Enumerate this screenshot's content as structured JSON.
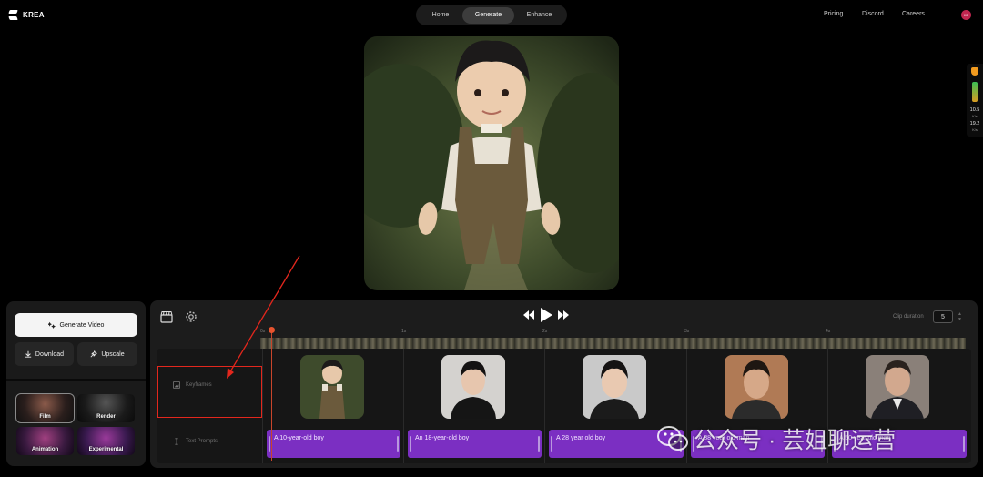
{
  "app": {
    "brand": "KREA"
  },
  "nav": {
    "tabs": [
      {
        "label": "Home",
        "active": false
      },
      {
        "label": "Generate",
        "active": true
      },
      {
        "label": "Enhance",
        "active": false
      }
    ],
    "links": [
      "Pricing",
      "Discord",
      "Careers"
    ],
    "avatar_initials": "KE"
  },
  "speed_widget": {
    "up_value": "10.5",
    "up_unit": "K/s",
    "down_value": "19.2",
    "down_unit": "K/s"
  },
  "left_panel": {
    "generate_label": "Generate Video",
    "download_label": "Download",
    "upscale_label": "Upscale",
    "styles": [
      {
        "label": "Film",
        "selected": true
      },
      {
        "label": "Render",
        "selected": false
      },
      {
        "label": "Animation",
        "selected": false
      },
      {
        "label": "Experimental",
        "selected": false
      }
    ]
  },
  "timeline": {
    "clip_duration_label": "Clip duration",
    "clip_duration_value": "5",
    "ruler": [
      "0s",
      "1s",
      "2s",
      "3s",
      "4s"
    ],
    "keyframes_label": "Keyframes",
    "text_prompts_label": "Text Prompts",
    "prompts": [
      "A 10-year-old boy",
      "An 18-year-old boy",
      "A 28 year old boy",
      "A 38 year old man",
      "A 50 year old man"
    ]
  },
  "watermark": {
    "text": "公众号 · 芸姐聊运营"
  },
  "colors": {
    "accent_purple": "#7b2fc2",
    "annotation_red": "#e3271d",
    "playhead": "#e7542f"
  }
}
